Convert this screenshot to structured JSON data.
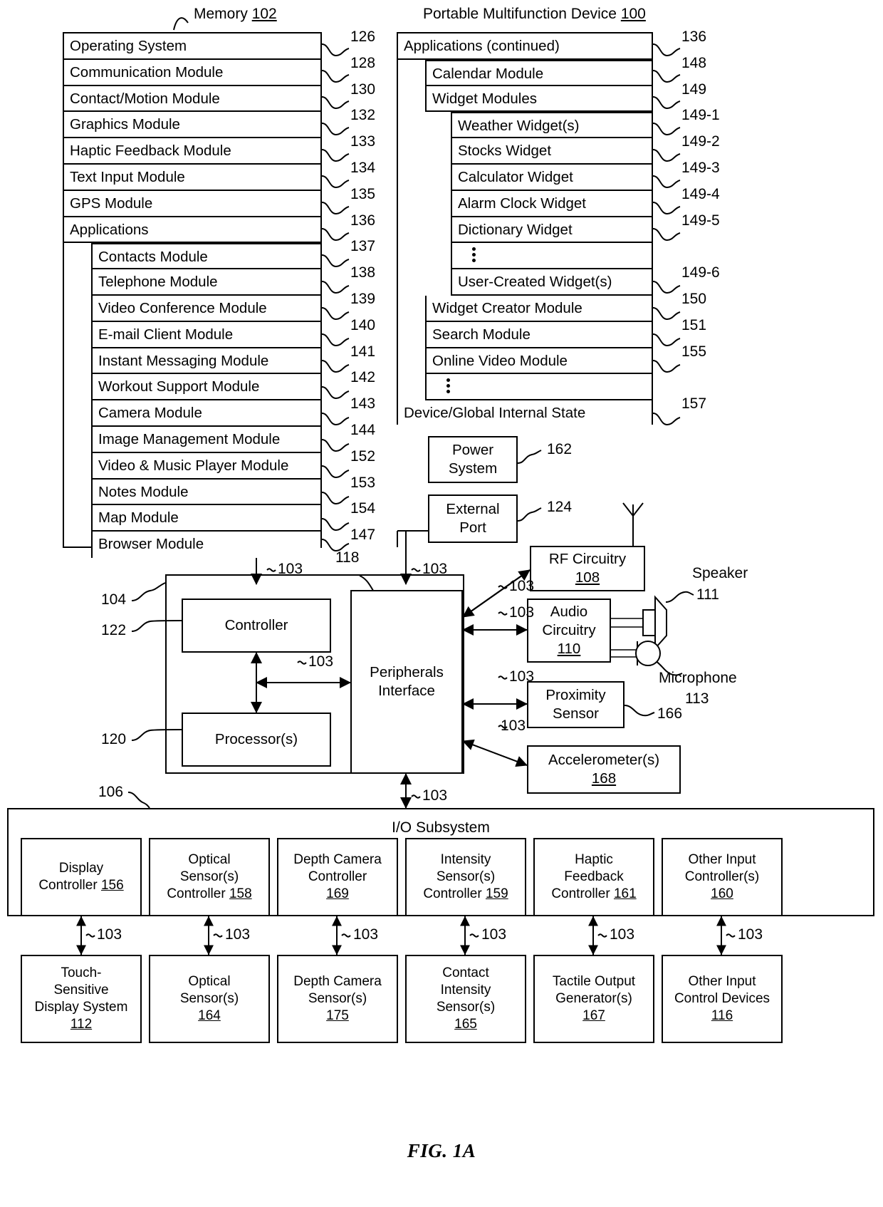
{
  "figure": {
    "caption": "FIG. 1A"
  },
  "memory_panel": {
    "title": "Memory",
    "title_ref": "102",
    "items": [
      {
        "label": "Operating System",
        "ref": "126",
        "indent": 0
      },
      {
        "label": "Communication Module",
        "ref": "128",
        "indent": 0
      },
      {
        "label": "Contact/Motion Module",
        "ref": "130",
        "indent": 0
      },
      {
        "label": "Graphics Module",
        "ref": "132",
        "indent": 0
      },
      {
        "label": "Haptic Feedback Module",
        "ref": "133",
        "indent": 0
      },
      {
        "label": "Text Input Module",
        "ref": "134",
        "indent": 0
      },
      {
        "label": "GPS Module",
        "ref": "135",
        "indent": 0
      },
      {
        "label": "Applications",
        "ref": "136",
        "indent": 0
      },
      {
        "label": "Contacts Module",
        "ref": "137",
        "indent": 1
      },
      {
        "label": "Telephone Module",
        "ref": "138",
        "indent": 1
      },
      {
        "label": "Video Conference Module",
        "ref": "139",
        "indent": 1
      },
      {
        "label": "E-mail Client Module",
        "ref": "140",
        "indent": 1
      },
      {
        "label": "Instant Messaging Module",
        "ref": "141",
        "indent": 1
      },
      {
        "label": "Workout Support Module",
        "ref": "142",
        "indent": 1
      },
      {
        "label": "Camera Module",
        "ref": "143",
        "indent": 1
      },
      {
        "label": "Image Management Module",
        "ref": "144",
        "indent": 1
      },
      {
        "label": "Video & Music Player Module",
        "ref": "152",
        "indent": 1
      },
      {
        "label": "Notes Module",
        "ref": "153",
        "indent": 1
      },
      {
        "label": "Map Module",
        "ref": "154",
        "indent": 1
      },
      {
        "label": "Browser Module",
        "ref": "147",
        "indent": 1
      }
    ]
  },
  "device_panel": {
    "title": "Portable Multifunction Device",
    "title_ref": "100",
    "items": [
      {
        "label": "Applications (continued)",
        "ref": "136",
        "indent": 0
      },
      {
        "label": "Calendar Module",
        "ref": "148",
        "indent": 1
      },
      {
        "label": "Widget Modules",
        "ref": "149",
        "indent": 1
      },
      {
        "label": "Weather Widget(s)",
        "ref": "149-1",
        "indent": 2
      },
      {
        "label": "Stocks Widget",
        "ref": "149-2",
        "indent": 2
      },
      {
        "label": "Calculator Widget",
        "ref": "149-3",
        "indent": 2
      },
      {
        "label": "Alarm Clock Widget",
        "ref": "149-4",
        "indent": 2
      },
      {
        "label": "Dictionary Widget",
        "ref": "149-5",
        "indent": 2
      },
      {
        "label": "",
        "ref": "",
        "indent": 2,
        "dots": true
      },
      {
        "label": "User-Created Widget(s)",
        "ref": "149-6",
        "indent": 2
      },
      {
        "label": "Widget Creator Module",
        "ref": "150",
        "indent": 1
      },
      {
        "label": "Search Module",
        "ref": "151",
        "indent": 1
      },
      {
        "label": "Online Video Module",
        "ref": "155",
        "indent": 1
      },
      {
        "label": "",
        "ref": "",
        "indent": 1,
        "dots": true
      },
      {
        "label": "Device/Global Internal State",
        "ref": "157",
        "indent": 0
      }
    ]
  },
  "blocks": {
    "power_system": {
      "lines": [
        "Power",
        "System"
      ],
      "ref": "162"
    },
    "external_port": {
      "lines": [
        "External",
        "Port"
      ],
      "ref": "124"
    },
    "rf_circuitry": {
      "lines": [
        "RF Circuitry"
      ],
      "num": "108"
    },
    "audio_circuitry": {
      "lines": [
        "Audio",
        "Circuitry"
      ],
      "num": "110"
    },
    "proximity_sensor": {
      "lines": [
        "Proximity",
        "Sensor"
      ],
      "ref": "166"
    },
    "accelerometers": {
      "lines": [
        "Accelerometer(s)"
      ],
      "num": "168"
    },
    "controller": {
      "lines": [
        "Controller"
      ],
      "ref": "122"
    },
    "processors": {
      "lines": [
        "Processor(s)"
      ],
      "ref": "120"
    },
    "peripherals_interface": {
      "lines": [
        "Peripherals",
        "Interface"
      ],
      "ref": "118"
    },
    "cpu_group_ref": "104",
    "speaker": {
      "label": "Speaker",
      "ref": "111"
    },
    "microphone": {
      "label": "Microphone",
      "ref": "113"
    },
    "io_subsystem": {
      "label": "I/O Subsystem",
      "ref": "106"
    }
  },
  "io_controllers": [
    {
      "lines": [
        "Display",
        "Controller"
      ],
      "num": "156",
      "inline_num": true
    },
    {
      "lines": [
        "Optical",
        "Sensor(s)",
        "Controller"
      ],
      "num": "158",
      "inline_num": true
    },
    {
      "lines": [
        "Depth Camera",
        "Controller"
      ],
      "num": "169",
      "inline_num": false
    },
    {
      "lines": [
        "Intensity",
        "Sensor(s)",
        "Controller"
      ],
      "num": "159",
      "inline_num": true
    },
    {
      "lines": [
        "Haptic",
        "Feedback",
        "Controller"
      ],
      "num": "161",
      "inline_num": true
    },
    {
      "lines": [
        "Other Input",
        "Controller(s)"
      ],
      "num": "160",
      "inline_num": false
    }
  ],
  "io_devices": [
    {
      "lines": [
        "Touch-",
        "Sensitive",
        "Display System"
      ],
      "num": "112"
    },
    {
      "lines": [
        "Optical",
        "Sensor(s)"
      ],
      "num": "164"
    },
    {
      "lines": [
        "Depth Camera",
        "Sensor(s)"
      ],
      "num": "175"
    },
    {
      "lines": [
        "Contact",
        "Intensity",
        "Sensor(s)"
      ],
      "num": "165"
    },
    {
      "lines": [
        "Tactile Output",
        "Generator(s)"
      ],
      "num": "167"
    },
    {
      "lines": [
        "Other Input",
        "Control Devices"
      ],
      "num": "116"
    }
  ],
  "bus_labels": {
    "bus": "103",
    "occurrences": 14
  },
  "colors": {
    "line": "#000000",
    "background": "#ffffff"
  }
}
